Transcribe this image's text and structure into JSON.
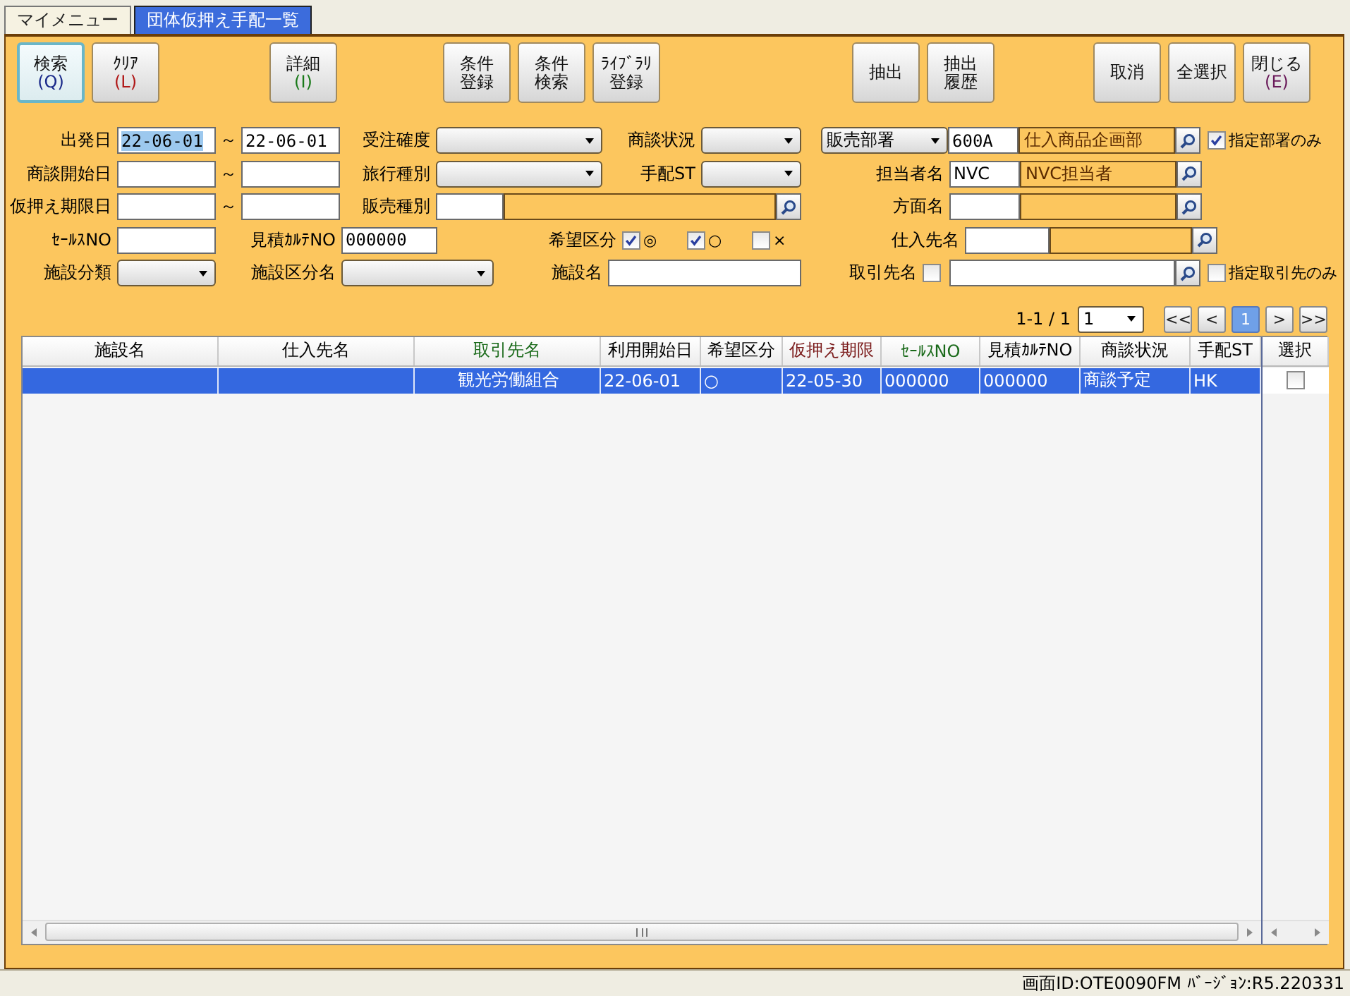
{
  "tabs": [
    {
      "label": "マイメニュー",
      "selected": false
    },
    {
      "label": "団体仮押え手配一覧",
      "selected": true
    }
  ],
  "toolbar": {
    "groups": [
      [
        {
          "lines": [
            "検索"
          ],
          "shortcut": "(Q)",
          "color": "#1a2a8a",
          "focused": true
        },
        {
          "lines": [
            "ｸﾘｱ"
          ],
          "shortcut": "(L)",
          "color": "#b01818",
          "focused": false
        }
      ],
      [
        {
          "lines": [
            "詳細"
          ],
          "shortcut": "(I)",
          "color": "#1a7a1a",
          "focused": false
        }
      ],
      [
        {
          "lines": [
            "条件",
            "登録"
          ],
          "focused": false
        },
        {
          "lines": [
            "条件",
            "検索"
          ],
          "focused": false
        },
        {
          "lines": [
            "ﾗｲﾌﾞﾗﾘ",
            "登録"
          ],
          "focused": false
        }
      ],
      [
        {
          "lines": [
            "抽出"
          ],
          "focused": false
        },
        {
          "lines": [
            "抽出",
            "履歴"
          ],
          "focused": false
        }
      ],
      [
        {
          "lines": [
            "取消"
          ],
          "focused": false
        },
        {
          "lines": [
            "全選択"
          ],
          "focused": false
        },
        {
          "lines": [
            "閉じる"
          ],
          "shortcut": "(E)",
          "color": "#6a1a5a",
          "focused": false
        }
      ]
    ]
  },
  "form": {
    "rows": [
      [
        {
          "kind": "date_range",
          "label": "出発日",
          "from": "22-06-01",
          "to": "22-06-01",
          "separator": "～",
          "from_selected": true
        },
        {
          "kind": "combo",
          "label": "受注確度"
        },
        {
          "kind": "combo",
          "label": "商談状況"
        },
        {
          "kind": "dept_lookup",
          "combo": "販売部署",
          "code": "600A",
          "name": "仕入商品企画部",
          "option": {
            "label": "指定部署のみ",
            "checked": true
          }
        }
      ],
      [
        {
          "kind": "date_range",
          "label": "商談開始日",
          "separator": "～"
        },
        {
          "kind": "combo",
          "label": "旅行種別"
        },
        {
          "kind": "combo",
          "label": "手配ST"
        },
        {
          "kind": "lookup",
          "label": "担当者名",
          "code": "NVC",
          "name": "NVC担当者"
        }
      ],
      [
        {
          "kind": "date_range",
          "label": "仮押え期限日",
          "separator": "～"
        },
        {
          "kind": "lookup",
          "label": "販売種別"
        },
        "",
        {
          "kind": "lookup",
          "label": "方面名"
        }
      ],
      [
        {
          "kind": "text",
          "label": "ｾｰﾙｽNO"
        },
        {
          "kind": "text",
          "label": "見積ｶﾙﾃNO",
          "value": "000000"
        },
        {
          "kind": "choices",
          "label": "希望区分",
          "options": [
            {
              "label": "◎",
              "checked": true
            },
            {
              "label": "○",
              "checked": true
            },
            {
              "label": "×",
              "checked": false
            }
          ]
        },
        {
          "kind": "lookup",
          "label": "仕入先名"
        }
      ],
      [
        {
          "kind": "combo",
          "label": "施設分類"
        },
        {
          "kind": "combo",
          "label": "施設区分名"
        },
        {
          "kind": "text",
          "label": "施設名"
        },
        {
          "kind": "partner",
          "label": "取引先名",
          "checked": false,
          "option": {
            "label": "指定取引先のみ",
            "checked": false
          }
        }
      ]
    ]
  },
  "pager": {
    "summary": "1-1 / 1",
    "page": "1",
    "buttons": [
      {
        "label": "<<",
        "selected": false
      },
      {
        "label": "<",
        "selected": false
      },
      {
        "label": "1",
        "selected": true
      },
      {
        "label": ">",
        "selected": false
      },
      {
        "label": ">>",
        "selected": false
      }
    ]
  },
  "table": {
    "columns": [
      {
        "label": "施設名",
        "color": "#000000"
      },
      {
        "label": "仕入先名",
        "color": "#000000"
      },
      {
        "label": "取引先名",
        "color": "#1a6a1a"
      },
      {
        "label": "利用開始日",
        "color": "#000000"
      },
      {
        "label": "希望区分",
        "color": "#000000"
      },
      {
        "label": "仮押え期限",
        "color": "#7a1a1a"
      },
      {
        "label": "ｾｰﾙｽNO",
        "color": "#1a6a1a"
      },
      {
        "label": "見積ｶﾙﾃNO",
        "color": "#000000"
      },
      {
        "label": "商談状況",
        "color": "#000000"
      },
      {
        "label": "手配ST",
        "color": "#000000"
      },
      {
        "label": "選択",
        "color": "#000000"
      }
    ],
    "rows": [
      {
        "selected": true,
        "checked": false,
        "cells": [
          null,
          null,
          "観光労働組合",
          "22-06-01",
          "○",
          "22-05-30",
          "000000",
          "000000",
          "商談予定",
          "HK"
        ]
      }
    ]
  },
  "status_bar": "画面ID:OTE0090FM ﾊﾞｰｼﾞｮﾝ:R5.220331"
}
